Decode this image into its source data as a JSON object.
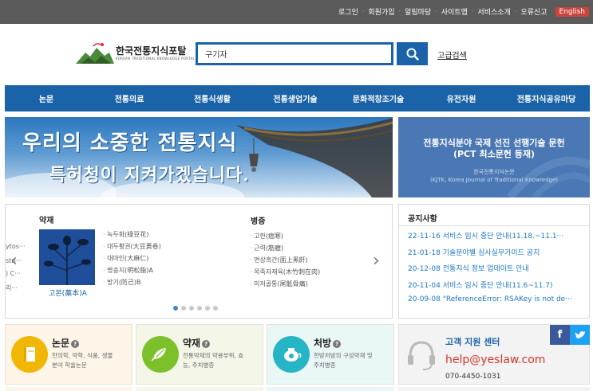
{
  "top_links": [
    "로그인",
    "회원가입",
    "알림마당",
    "사이트맵",
    "서비스소개",
    "오류신고"
  ],
  "english": "English",
  "logo": {
    "title": "한국전통지식포탈",
    "subtitle": "KOREAN TRADITIONAL KNOWLEDGE PORTAL"
  },
  "search": {
    "value": "구기자"
  },
  "advanced_search": "고급검색",
  "nav": [
    "논문",
    "전통의료",
    "전통식생활",
    "전통생업기술",
    "문화적창조기술",
    "유전자원",
    "전통지식공유마당"
  ],
  "banner": {
    "line1": "우리의 소중한 전통지식",
    "line2": "특허청이 지켜가겠습니다."
  },
  "banner_right": {
    "title_line1": "전통지식분야 국제 선진 선행기술 문헌",
    "title_line2": "(PCT 최소문헌 등재)",
    "sub_line1": "한국전통지식논문",
    "sub_line2": "(KJTK, Korea Journal of Traditional Knowledge)"
  },
  "herb": {
    "left_fragments": [
      "ytos···",
      "stri···",
      ") C···",
      "리···"
    ],
    "yakjae_title": "약재",
    "caption": "고본(藁本)A",
    "yakjae_items": [
      "녹두화(綠豆花)",
      "대두황권(大豆黃卷)",
      "대마인(大麻仁)",
      "명송지(明松脂)A",
      "방기(防己)B"
    ],
    "byeongjeung_title": "병증",
    "byeongjeung_items": [
      "고한(痼寒)",
      "근력(筋癧)",
      "면상흑간(面上黑皯)",
      "목죽자재육(木竹刺在肉)",
      "미저골통(尾骶骨痛)"
    ]
  },
  "notice": {
    "title": "공지사항",
    "items": [
      "22-11-16 서비스 임시 중단 안내(11.18.~11.1···",
      "21-01-18 기술분야별 심사실무가이드 공지",
      "20-12-08 전통지식 정보 업데이트 안내",
      "20-11-04 서비스 임시 중단 안내(11.6~11.7)",
      "20-09-08 \"ReferenceError: RSAKey is not de···"
    ]
  },
  "cards": [
    {
      "title": "논문",
      "desc1": "한의학, 약학, 식품, 생물",
      "desc2": "분야 학술논문",
      "color": "#f2b705",
      "bg": "#fdf6e8"
    },
    {
      "title": "약재",
      "desc1": "전통약재의 약용부위, 효",
      "desc2": "능, 주치병증",
      "color": "#7cc12a",
      "bg": "#f4f7e8"
    },
    {
      "title": "처방",
      "desc1": "한방처방의 구성약재 및",
      "desc2": "주치병증",
      "color": "#26b5c4",
      "bg": "#e9f7f6"
    }
  ],
  "support": {
    "title": "고객 지원 센터",
    "email": "help@yeslaw.com",
    "phone": "070-4450-1031"
  },
  "colors": {
    "brand_blue": "#1a63a8",
    "top_bar": "#5b5b5b",
    "notice_link": "#1a78c4",
    "english_badge": "#c9443b"
  }
}
